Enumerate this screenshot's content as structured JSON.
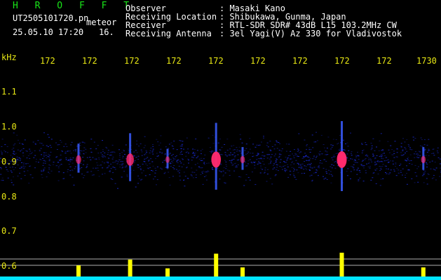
{
  "app": {
    "name": "H R O F F T",
    "filename": "UT2505101720.pn",
    "event_type": "meteor",
    "date_time": "25.05.10 17:20",
    "count": "16."
  },
  "info": [
    {
      "label": "Observer",
      "value": ": Masaki Kano"
    },
    {
      "label": "Receiving Location",
      "value": ": Shibukawa, Gunma, Japan"
    },
    {
      "label": "Receiver",
      "value": ": RTL-SDR SDR# 43dB L15 103.2MHz CW"
    },
    {
      "label": "Receiving Antenna",
      "value": ": 3el Yagi(V) Az 330 for Vladivostok"
    }
  ],
  "y_axis": {
    "unit": "kHz",
    "ticks": [
      "1.1",
      "1.0",
      "0.9",
      "0.8",
      "0.7",
      "0.6"
    ]
  },
  "x_axis": {
    "ticks": [
      "172",
      "172",
      "172",
      "172",
      "172",
      "172",
      "172",
      "172",
      "172",
      "1730"
    ]
  },
  "colors": {
    "background": "#000000",
    "header_green": "#19e619",
    "axis_yellow": "#e8e814",
    "noise_band": "#1a2bd6",
    "echo_hot": "#ff2a6d",
    "histogram": "#ffff00",
    "baseline": "#00e5ff"
  },
  "meteor_echoes": [
    {
      "time_frac": 0.178,
      "strength": 0.35
    },
    {
      "time_frac": 0.295,
      "strength": 0.65
    },
    {
      "time_frac": 0.38,
      "strength": 0.2
    },
    {
      "time_frac": 0.49,
      "strength": 0.95
    },
    {
      "time_frac": 0.55,
      "strength": 0.25
    },
    {
      "time_frac": 0.775,
      "strength": 1.0
    },
    {
      "time_frac": 0.96,
      "strength": 0.25
    }
  ]
}
